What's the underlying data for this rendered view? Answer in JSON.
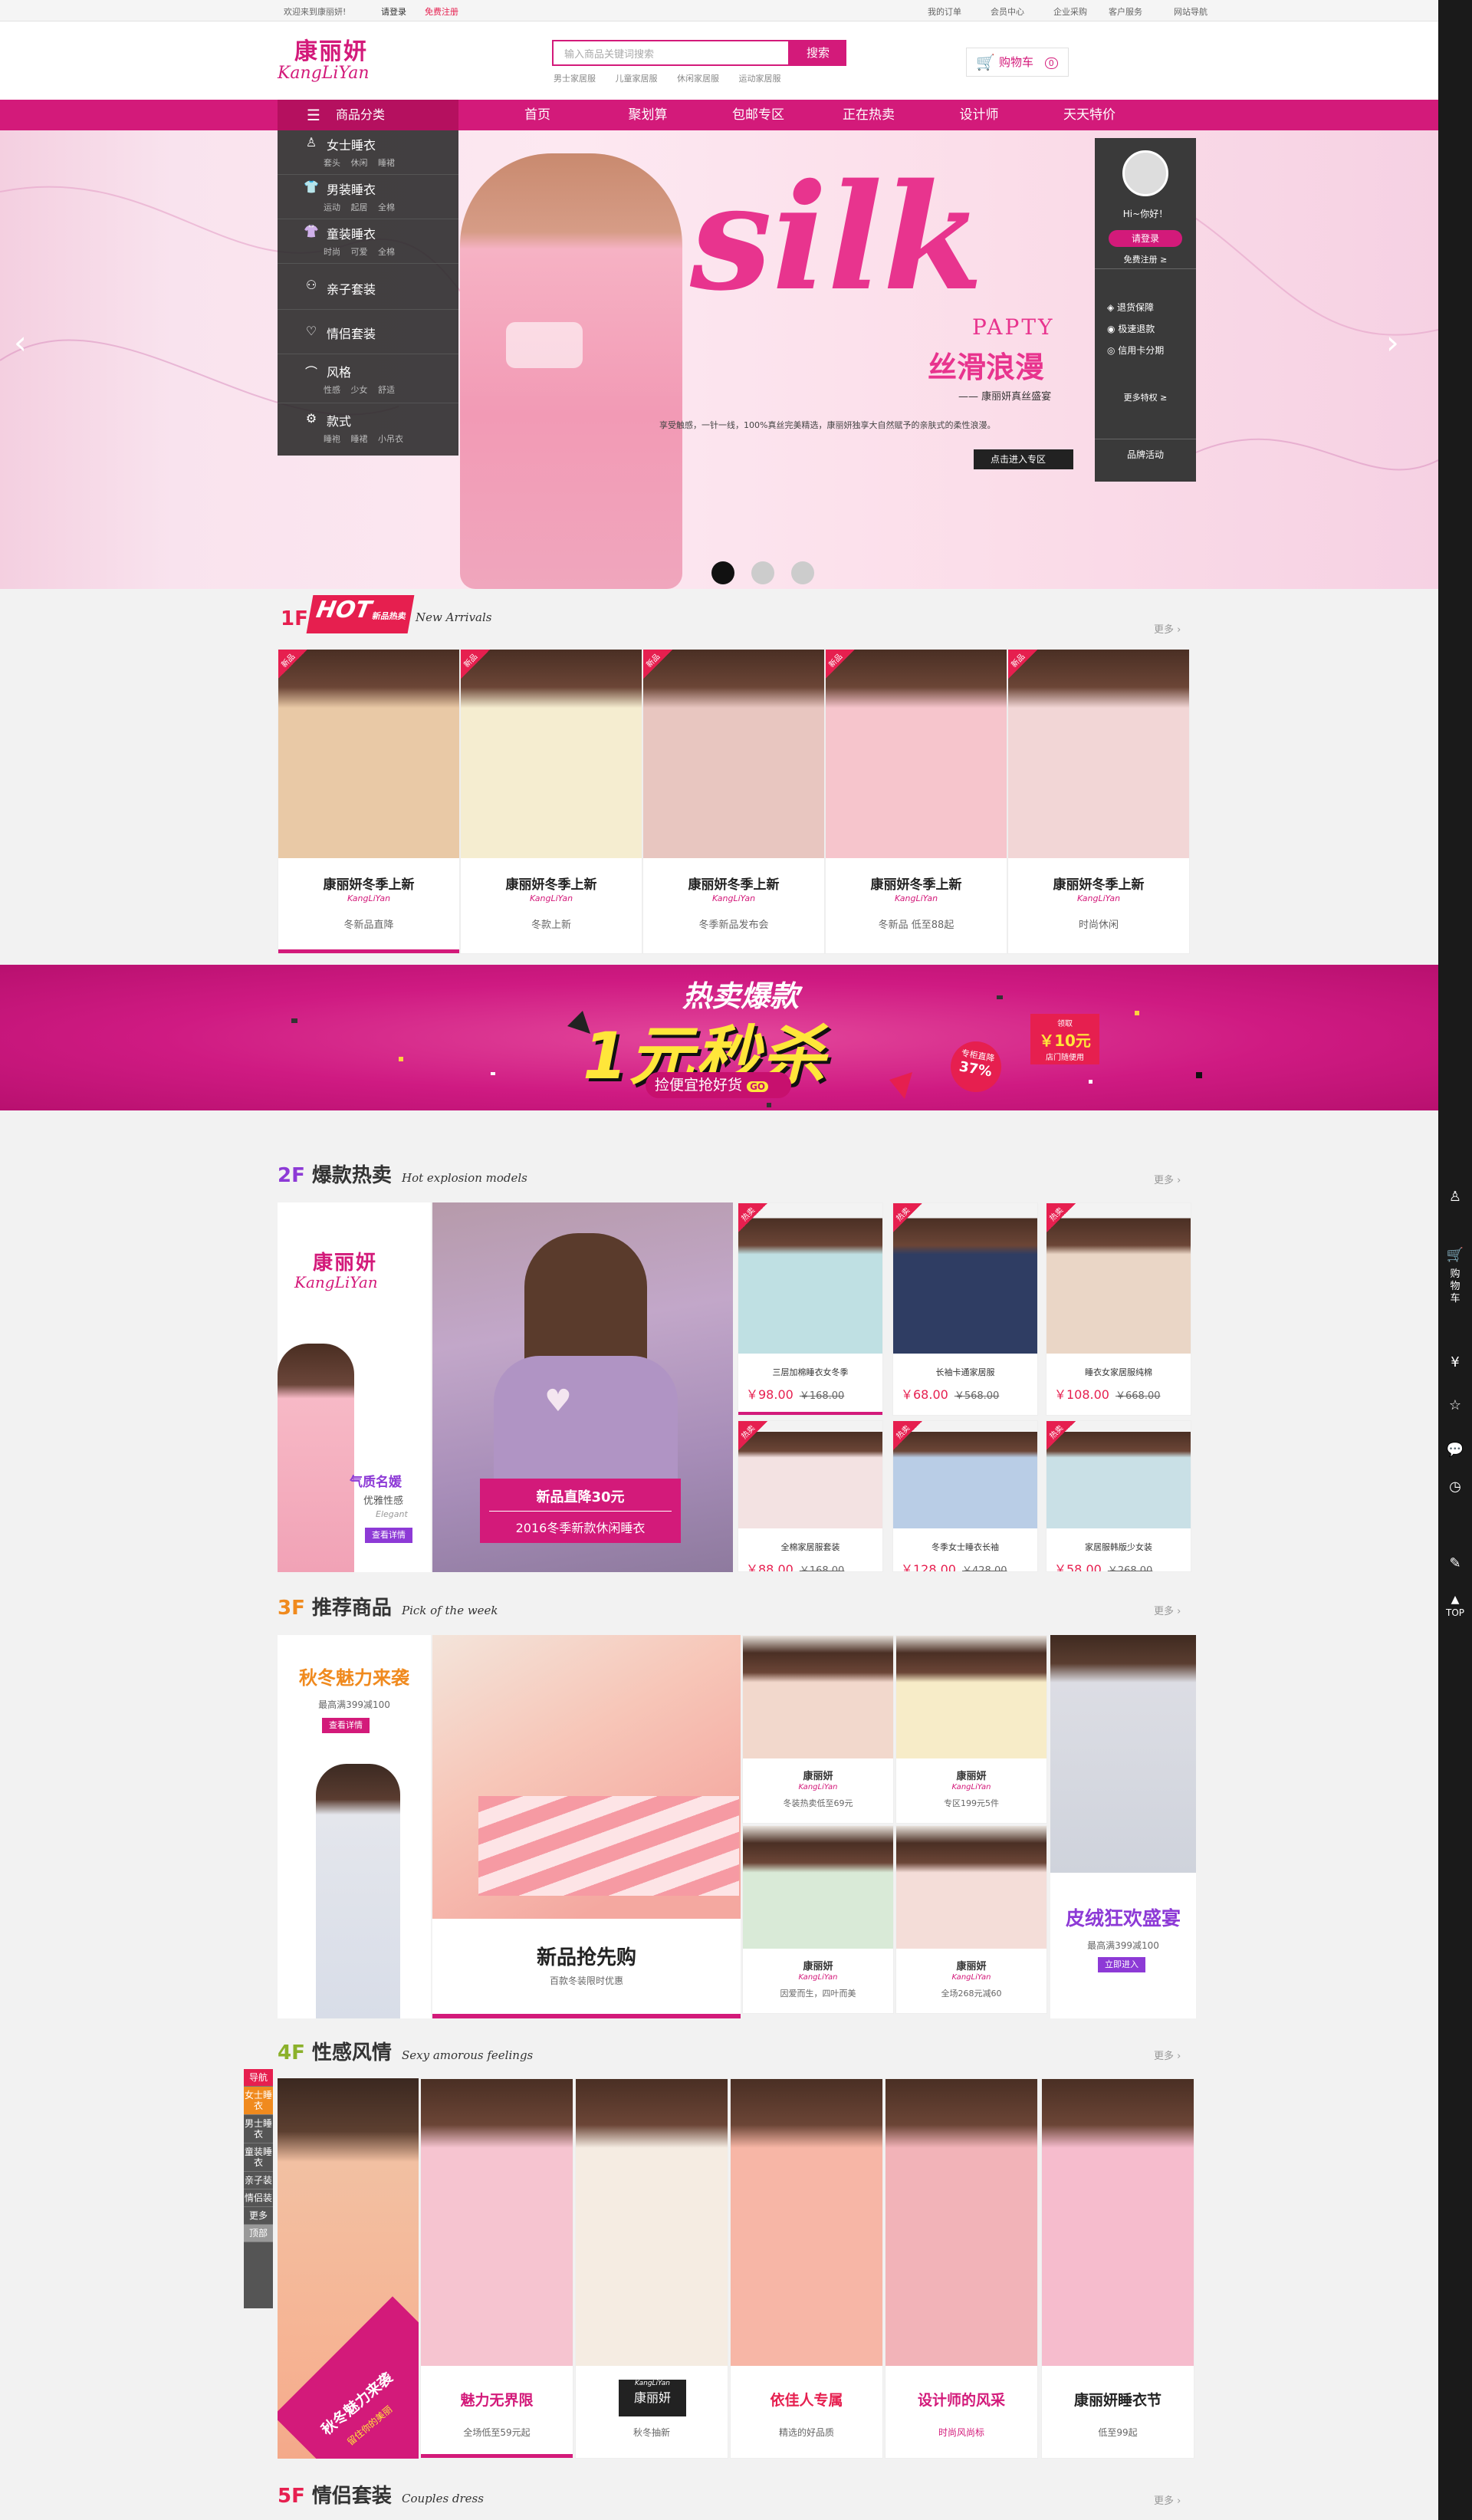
{
  "topbar": {
    "welcome": "欢迎来到康丽妍!",
    "login": "请登录",
    "register": "免费注册",
    "my_orders": "我的订单",
    "member": "会员中心",
    "corporate": "企业采购",
    "service": "客户服务",
    "site_nav": "网站导航"
  },
  "header": {
    "logo_cn": "康丽妍",
    "logo_en": "KangLiYan",
    "search_placeholder": "输入商品关键词搜索",
    "search_button": "搜索",
    "hot_words": [
      "男士家居服",
      "儿童家居服",
      "休闲家居服",
      "运动家居服"
    ],
    "cart_label": "购物车",
    "cart_count": "0"
  },
  "nav": {
    "category_label": "商品分类",
    "items": [
      "首页",
      "聚划算",
      "包邮专区",
      "正在热卖",
      "设计师",
      "天天特价"
    ]
  },
  "categories": [
    {
      "title": "女士睡衣",
      "subs": "套头 休闲 睡裙",
      "icon": "person-icon"
    },
    {
      "title": "男装睡衣",
      "subs": "运动 起居 全棉",
      "icon": "shirt-icon"
    },
    {
      "title": "童装睡衣",
      "subs": "时尚 可爱 全棉",
      "icon": "tshirt-icon"
    },
    {
      "title": "亲子套装",
      "subs": "",
      "icon": "family-icon"
    },
    {
      "title": "情侣套装",
      "subs": "",
      "icon": "heart-icon"
    },
    {
      "title": "风格",
      "subs": "性感 少女 舒适",
      "icon": "hanger-icon"
    },
    {
      "title": "款式",
      "subs": "睡袍 睡裙 小吊衣",
      "icon": "gear-icon"
    }
  ],
  "banner": {
    "headline": "silk",
    "party": "PAPTY",
    "cn_title": "丝滑浪漫",
    "subtitle": "—— 康丽妍真丝盛宴",
    "desc": "享受触感，一针一线，100%真丝完美精选，康丽妍独享大自然赋予的亲肤式的柔性浪漫。",
    "cta": "点击进入专区"
  },
  "user_panel": {
    "greeting": "Hi~你好！",
    "login": "请登录",
    "register": "免费注册 ≥",
    "perks": [
      "退货保障",
      "极速退款",
      "信用卡分期"
    ],
    "more": "更多特权 ≥",
    "activity": "品牌活动"
  },
  "floor1": {
    "num": "1F",
    "hot": "HOT",
    "hot_sub": "新品热卖",
    "en": "New Arrivals",
    "more": "更多",
    "tag": "新品",
    "cards": [
      {
        "title": "康丽妍冬季上新",
        "brand": "KangLiYan",
        "sub": "冬新品直降"
      },
      {
        "title": "康丽妍冬季上新",
        "brand": "KangLiYan",
        "sub": "冬款上新"
      },
      {
        "title": "康丽妍冬季上新",
        "brand": "KangLiYan",
        "sub": "冬季新品发布会"
      },
      {
        "title": "康丽妍冬季上新",
        "brand": "KangLiYan",
        "sub": "冬新品 低至88起"
      },
      {
        "title": "康丽妍冬季上新",
        "brand": "KangLiYan",
        "sub": "时尚休闲"
      }
    ]
  },
  "promo": {
    "top": "热卖爆款",
    "main": "1元秒杀",
    "sub": "捡便宜抢好货",
    "go": "GO",
    "discount_label": "专柜直降",
    "discount": "37%",
    "coupon_label": "领取",
    "coupon": "￥10元",
    "coupon_sub": "店门随便用"
  },
  "floor2": {
    "num": "2F",
    "title": "爆款热卖",
    "en": "Hot explosion models",
    "more": "更多",
    "left_logo_cn": "康丽妍",
    "left_logo_en": "KangLiYan",
    "left_title": "气质名媛",
    "left_sub": "优雅性感",
    "left_en": "Elegant",
    "left_btn": "查看详情",
    "center_tag": "新品直降30元",
    "center_sub": "2016冬季新款休闲睡衣",
    "tag": "热卖",
    "products": [
      {
        "name": "三层加棉睡衣女冬季",
        "price": "￥98.00",
        "old": "￥168.00"
      },
      {
        "name": "长袖卡通家居服",
        "price": "￥68.00",
        "old": "￥568.00"
      },
      {
        "name": "睡衣女家居服纯棉",
        "price": "￥108.00",
        "old": "￥668.00"
      },
      {
        "name": "全棉家居服套装",
        "price": "￥88.00",
        "old": "￥168.00"
      },
      {
        "name": "冬季女士睡衣长袖",
        "price": "￥128.00",
        "old": "￥428.00"
      },
      {
        "name": "家居服韩版少女装",
        "price": "￥58.00",
        "old": "￥268.00"
      }
    ]
  },
  "floor3": {
    "num": "3F",
    "title": "推荐商品",
    "en": "Pick of the week",
    "more": "更多",
    "left_title": "秋冬魅力来袭",
    "left_sub": "最高满399减100",
    "left_btn": "查看详情",
    "center_title": "新品抢先购",
    "center_sub": "百款冬装限时优惠",
    "right_title": "皮绒狂欢盛宴",
    "right_sub": "最高满399减100",
    "right_btn": "立即进入",
    "grid": [
      {
        "brand": "康丽妍",
        "en": "KangLiYan",
        "sub": "冬装热卖低至69元"
      },
      {
        "brand": "康丽妍",
        "en": "KangLiYan",
        "sub": "专区199元5件"
      },
      {
        "brand": "康丽妍",
        "en": "KangLiYan",
        "sub": "因爱而生，四叶而美"
      },
      {
        "brand": "康丽妍",
        "en": "KangLiYan",
        "sub": "全场268元减60"
      }
    ]
  },
  "floor4": {
    "num": "4F",
    "title": "性感风情",
    "en": "Sexy amorous feelings",
    "more": "更多",
    "left_badge": "秋冬魅力来袭",
    "left_badge_sub": "留住你的美丽",
    "cards": [
      {
        "title": "魅力无界限",
        "sub": "全场低至59元起"
      },
      {
        "title": "康丽妍",
        "sub": "秋冬抽新",
        "logo_en": "KangLiYan"
      },
      {
        "title": "依佳人专属",
        "sub": "精选的好品质"
      },
      {
        "title": "设计师的风采",
        "sub": "时尚风尚标"
      },
      {
        "title": "康丽妍睡衣节",
        "sub": "低至99起"
      }
    ]
  },
  "floor5": {
    "num": "5F",
    "title": "情侣套装",
    "en": "Couples dress",
    "more": "更多"
  },
  "left_nav": [
    "导航",
    "女士睡衣",
    "男士睡衣",
    "童装睡衣",
    "亲子装",
    "情侣装",
    "更多",
    "顶部"
  ],
  "right_sidebar": {
    "cart": "购物车",
    "top": "TOP"
  },
  "colors": {
    "brand": "#d31a7a",
    "accent": "#e61f4f",
    "dark": "#333333"
  }
}
